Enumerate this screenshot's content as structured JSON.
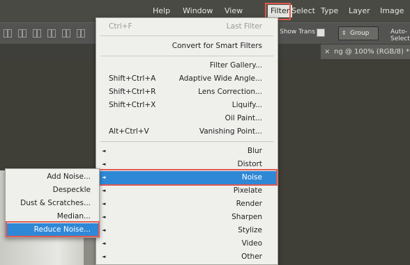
{
  "menubar": {
    "items": [
      "Image",
      "Layer",
      "Type",
      "Select",
      "Filter",
      "View",
      "Window",
      "Help"
    ]
  },
  "options": {
    "auto_select_label": "Auto-Select:",
    "group_select_value": "Group",
    "show_transform_label": "Show Trans"
  },
  "document_tab": {
    "title": "ng @ 100% (RGB/8) *",
    "close_glyph": "×"
  },
  "filter_menu": {
    "items": [
      {
        "label": "Last Filter",
        "shortcut": "Ctrl+F",
        "disabled": true
      },
      {
        "label": "Convert for Smart Filters"
      },
      {
        "label": "Filter Gallery..."
      },
      {
        "label": "Adaptive Wide Angle...",
        "shortcut": "Shift+Ctrl+A"
      },
      {
        "label": "Lens Correction...",
        "shortcut": "Shift+Ctrl+R"
      },
      {
        "label": "Liquify...",
        "shortcut": "Shift+Ctrl+X"
      },
      {
        "label": "Oil Paint..."
      },
      {
        "label": "Vanishing Point...",
        "shortcut": "Alt+Ctrl+V"
      },
      {
        "label": "Blur"
      },
      {
        "label": "Distort"
      },
      {
        "label": "Noise"
      },
      {
        "label": "Pixelate"
      },
      {
        "label": "Render"
      },
      {
        "label": "Sharpen"
      },
      {
        "label": "Stylize"
      },
      {
        "label": "Video"
      },
      {
        "label": "Other"
      }
    ]
  },
  "noise_submenu": {
    "items": [
      "Add Noise...",
      "Despeckle",
      "Dust & Scratches...",
      "Median...",
      "Reduce Noise..."
    ]
  },
  "colors": {
    "highlight_blue": "#2f88d6",
    "annotation_red": "#e05a50"
  },
  "icons": {
    "submenu_arrow": "◄"
  }
}
